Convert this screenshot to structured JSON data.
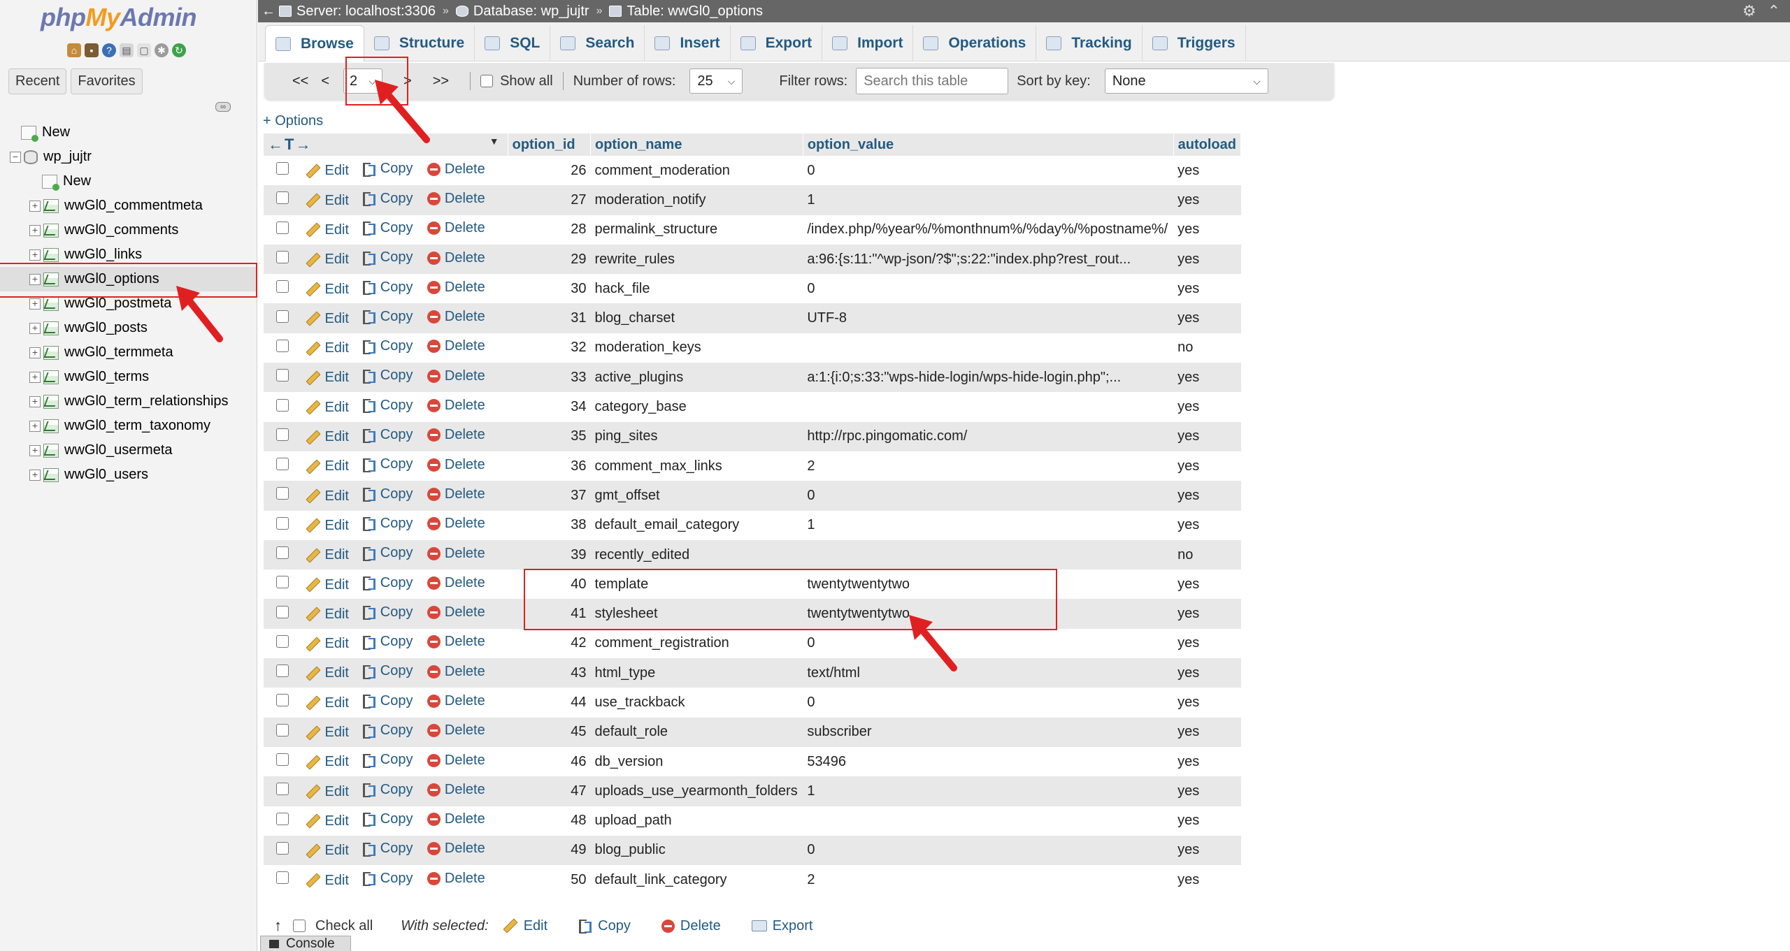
{
  "logo": {
    "php": "php",
    "my": "My",
    "admin": "Admin"
  },
  "nav": {
    "tabs": [
      "Recent",
      "Favorites"
    ],
    "tree": [
      {
        "label": "New",
        "level": 1,
        "icon": "new-icon"
      },
      {
        "label": "wp_jujtr",
        "level": 0,
        "icon": "database-icon"
      },
      {
        "label": "New",
        "level": 2,
        "icon": "new-icon"
      },
      {
        "label": "wwGl0_commentmeta",
        "level": 2,
        "icon": "table-icon"
      },
      {
        "label": "wwGl0_comments",
        "level": 2,
        "icon": "table-icon"
      },
      {
        "label": "wwGl0_links",
        "level": 2,
        "icon": "table-icon"
      },
      {
        "label": "wwGl0_options",
        "level": 2,
        "icon": "table-icon",
        "selected": true
      },
      {
        "label": "wwGl0_postmeta",
        "level": 2,
        "icon": "table-icon"
      },
      {
        "label": "wwGl0_posts",
        "level": 2,
        "icon": "table-icon"
      },
      {
        "label": "wwGl0_termmeta",
        "level": 2,
        "icon": "table-icon"
      },
      {
        "label": "wwGl0_terms",
        "level": 2,
        "icon": "table-icon"
      },
      {
        "label": "wwGl0_term_relationships",
        "level": 2,
        "icon": "table-icon"
      },
      {
        "label": "wwGl0_term_taxonomy",
        "level": 2,
        "icon": "table-icon"
      },
      {
        "label": "wwGl0_usermeta",
        "level": 2,
        "icon": "table-icon"
      },
      {
        "label": "wwGl0_users",
        "level": 2,
        "icon": "table-icon"
      }
    ]
  },
  "breadcrumb": {
    "server": "Server: localhost:3306",
    "database": "Database: wp_jujtr",
    "table": "Table: wwGl0_options",
    "separator": "»"
  },
  "menu": {
    "tabs": [
      "Browse",
      "Structure",
      "SQL",
      "Search",
      "Insert",
      "Export",
      "Import",
      "Operations",
      "Tracking",
      "Triggers"
    ],
    "active": "Browse"
  },
  "pager": {
    "first": "<<",
    "prev": "<",
    "page": "2",
    "next": ">",
    "last": ">>",
    "show_all": "Show all",
    "rows_label": "Number of rows:",
    "rows_value": "25",
    "filter_label": "Filter rows:",
    "filter_placeholder": "Search this table",
    "sort_label": "Sort by key:",
    "sort_value": "None"
  },
  "options_link": "+ Options",
  "table": {
    "arrows": "←T→",
    "columns": [
      "option_id",
      "option_name",
      "option_value",
      "autoload"
    ],
    "action_labels": {
      "edit": "Edit",
      "copy": "Copy",
      "delete": "Delete"
    },
    "rows": [
      {
        "id": "26",
        "name": "comment_moderation",
        "value": "0",
        "autoload": "yes"
      },
      {
        "id": "27",
        "name": "moderation_notify",
        "value": "1",
        "autoload": "yes"
      },
      {
        "id": "28",
        "name": "permalink_structure",
        "value": "/index.php/%year%/%monthnum%/%day%/%postname%/",
        "autoload": "yes"
      },
      {
        "id": "29",
        "name": "rewrite_rules",
        "value": "a:96:{s:11:\"^wp-json/?$\";s:22:\"index.php?rest_rout...",
        "autoload": "yes"
      },
      {
        "id": "30",
        "name": "hack_file",
        "value": "0",
        "autoload": "yes"
      },
      {
        "id": "31",
        "name": "blog_charset",
        "value": "UTF-8",
        "autoload": "yes"
      },
      {
        "id": "32",
        "name": "moderation_keys",
        "value": "",
        "autoload": "no"
      },
      {
        "id": "33",
        "name": "active_plugins",
        "value": "a:1:{i:0;s:33:\"wps-hide-login/wps-hide-login.php\";...",
        "autoload": "yes"
      },
      {
        "id": "34",
        "name": "category_base",
        "value": "",
        "autoload": "yes"
      },
      {
        "id": "35",
        "name": "ping_sites",
        "value": "http://rpc.pingomatic.com/",
        "autoload": "yes"
      },
      {
        "id": "36",
        "name": "comment_max_links",
        "value": "2",
        "autoload": "yes"
      },
      {
        "id": "37",
        "name": "gmt_offset",
        "value": "0",
        "autoload": "yes"
      },
      {
        "id": "38",
        "name": "default_email_category",
        "value": "1",
        "autoload": "yes"
      },
      {
        "id": "39",
        "name": "recently_edited",
        "value": "",
        "autoload": "no"
      },
      {
        "id": "40",
        "name": "template",
        "value": "twentytwentytwo",
        "autoload": "yes"
      },
      {
        "id": "41",
        "name": "stylesheet",
        "value": "twentytwentytwo",
        "autoload": "yes"
      },
      {
        "id": "42",
        "name": "comment_registration",
        "value": "0",
        "autoload": "yes"
      },
      {
        "id": "43",
        "name": "html_type",
        "value": "text/html",
        "autoload": "yes"
      },
      {
        "id": "44",
        "name": "use_trackback",
        "value": "0",
        "autoload": "yes"
      },
      {
        "id": "45",
        "name": "default_role",
        "value": "subscriber",
        "autoload": "yes"
      },
      {
        "id": "46",
        "name": "db_version",
        "value": "53496",
        "autoload": "yes"
      },
      {
        "id": "47",
        "name": "uploads_use_yearmonth_folders",
        "value": "1",
        "autoload": "yes"
      },
      {
        "id": "48",
        "name": "upload_path",
        "value": "",
        "autoload": "yes"
      },
      {
        "id": "49",
        "name": "blog_public",
        "value": "0",
        "autoload": "yes"
      },
      {
        "id": "50",
        "name": "default_link_category",
        "value": "2",
        "autoload": "yes"
      }
    ]
  },
  "bottom": {
    "check_all": "Check all",
    "with_selected": "With selected:",
    "edit": "Edit",
    "copy": "Copy",
    "delete": "Delete",
    "export": "Export"
  },
  "console": "Console",
  "colors": {
    "accent": "#235a81",
    "annotation": "#e02020",
    "row_alt": "#e8e8e8"
  }
}
